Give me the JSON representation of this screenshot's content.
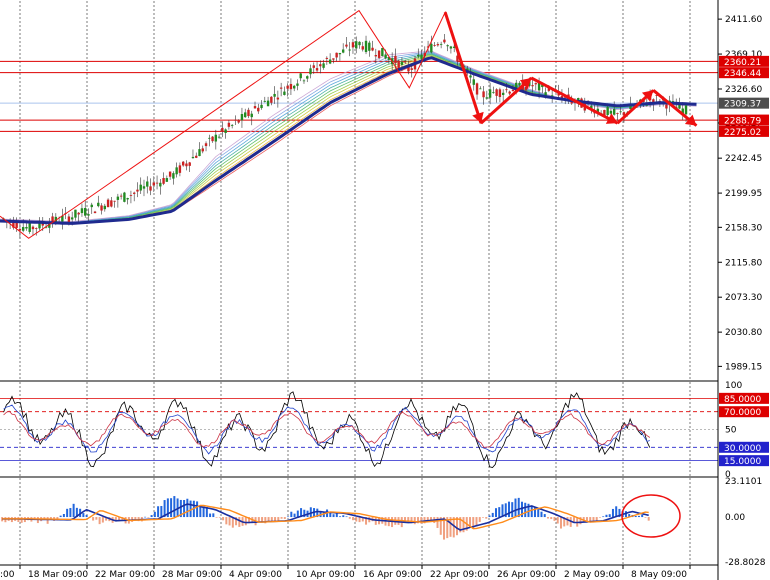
{
  "chart_data": {
    "type": "line",
    "main": {
      "type": "candlestick",
      "ylim": [
        1975,
        2430
      ],
      "yticks": [
        "2411.60",
        "2369.10",
        "2326.60",
        "2285.27",
        "2242.45",
        "2199.95",
        "2158.30",
        "2115.80",
        "2073.30",
        "2030.80",
        "1989.15"
      ],
      "price_boxes": [
        {
          "value": 2360.21,
          "label": "2360.21",
          "color": "#dd0000"
        },
        {
          "value": 2346.44,
          "label": "2346.44",
          "color": "#dd0000"
        },
        {
          "value": 2309.37,
          "label": "2309.37",
          "color": "#4d4d4d"
        },
        {
          "value": 2288.79,
          "label": "2288.79",
          "color": "#dd0000"
        },
        {
          "value": 2275.02,
          "label": "2275.02",
          "color": "#dd0000"
        }
      ],
      "hlines": [
        {
          "value": 2360.21,
          "color": "#dd0000"
        },
        {
          "value": 2346.44,
          "color": "#dd0000"
        },
        {
          "value": 2309.37,
          "color": "#aac4ee"
        },
        {
          "value": 2288.79,
          "color": "#dd0000"
        },
        {
          "value": 2275.02,
          "color": "#dd0000"
        }
      ],
      "wave_path": [
        [
          0.0,
          2172
        ],
        [
          0.04,
          2145
        ],
        [
          0.1,
          2180
        ],
        [
          0.5,
          2422
        ],
        [
          0.57,
          2328
        ],
        [
          0.62,
          2420
        ],
        [
          0.67,
          2285
        ],
        [
          0.74,
          2340
        ],
        [
          0.86,
          2285
        ],
        [
          0.91,
          2325
        ],
        [
          0.97,
          2282
        ]
      ],
      "ma_fast_anchors": [
        [
          0,
          2168
        ],
        [
          0.1,
          2165
        ],
        [
          0.18,
          2172
        ],
        [
          0.24,
          2185
        ],
        [
          0.3,
          2240
        ],
        [
          0.38,
          2290
        ],
        [
          0.46,
          2335
        ],
        [
          0.54,
          2365
        ],
        [
          0.6,
          2372
        ],
        [
          0.66,
          2350
        ],
        [
          0.74,
          2325
        ],
        [
          0.8,
          2310
        ],
        [
          0.86,
          2302
        ],
        [
          0.92,
          2308
        ],
        [
          0.97,
          2306
        ]
      ],
      "ma_slow_anchors": [
        [
          0,
          2166
        ],
        [
          0.1,
          2163
        ],
        [
          0.18,
          2168
        ],
        [
          0.24,
          2178
        ],
        [
          0.3,
          2215
        ],
        [
          0.38,
          2262
        ],
        [
          0.46,
          2310
        ],
        [
          0.54,
          2345
        ],
        [
          0.6,
          2365
        ],
        [
          0.66,
          2345
        ],
        [
          0.74,
          2320
        ],
        [
          0.8,
          2312
        ],
        [
          0.86,
          2306
        ],
        [
          0.92,
          2310
        ],
        [
          0.97,
          2308
        ]
      ]
    },
    "oscillator": {
      "type": "line",
      "ylim": [
        0,
        100
      ],
      "yticks": [
        "100",
        "50",
        "0"
      ],
      "levels": [
        {
          "value": 85,
          "label": "85.0000",
          "color": "#dd0000"
        },
        {
          "value": 70,
          "label": "70.0000",
          "color": "#dd0000"
        },
        {
          "value": 30,
          "label": "30.0000",
          "color": "#2222cc"
        },
        {
          "value": 15,
          "label": "15.0000",
          "color": "#2222cc"
        }
      ]
    },
    "macd": {
      "type": "bar",
      "ylim": [
        -28.8028,
        23.1101
      ],
      "yticks": [
        "23.1101",
        "0.00",
        "-28.8028"
      ]
    },
    "x_tick_labels": [
      ":00",
      "18 Mar 09:00",
      "22 Mar 09:00",
      "28 Mar 09:00",
      "4 Apr 09:00",
      "10 Apr 09:00",
      "16 Apr 09:00",
      "22 Apr 09:00",
      "26 Apr 09:00",
      "2 May 09:00",
      "8 May 09:00"
    ],
    "colors": {
      "bull": "#26a69a",
      "bear": "#dd2222",
      "wave": "#ee1111",
      "ma_fast": "#1f2a8f",
      "grid": "#444444"
    }
  }
}
